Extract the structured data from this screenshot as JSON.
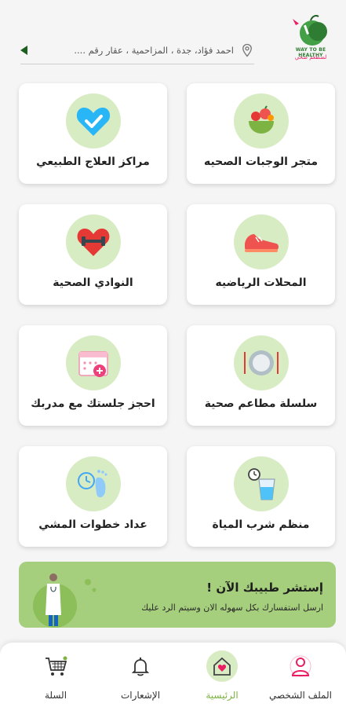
{
  "header": {
    "logo_text_en": "WAY TO BE HEALTHY",
    "logo_text_ar": "لصطعم صحي",
    "location_text": "احمد فؤاد، جدة ، المزاحمية ، عقار رقم ....",
    "pin_icon": "location-pin-icon",
    "back_icon": "back-arrow-icon"
  },
  "services": [
    {
      "label": "متجر الوجبات الصحيه",
      "icon": "healthy-food-bowl-icon"
    },
    {
      "label": "مراكز العلاج الطبيعي",
      "icon": "heart-check-icon"
    },
    {
      "label": "المحلات الرياضيه",
      "icon": "sneaker-icon"
    },
    {
      "label": "النوادي الصحية",
      "icon": "dumbbell-heart-icon"
    },
    {
      "label": "سلسلة مطاعم صحية",
      "icon": "plate-fork-knife-icon"
    },
    {
      "label": "احجز جلستك مع مدربك",
      "icon": "calendar-add-icon"
    },
    {
      "label": "منظم شرب المياة",
      "icon": "water-glass-timer-icon"
    },
    {
      "label": "عداد خطوات المشي",
      "icon": "footstep-counter-icon"
    }
  ],
  "consult": {
    "title": "إستشر طبيبك الآن !",
    "text": "ارسل استفسارك بكل سهوله الان وسيتم الرد عليك",
    "icon": "doctor-illustration"
  },
  "nav": {
    "items": [
      {
        "label": "الملف الشخصي",
        "icon": "profile-icon"
      },
      {
        "label": "الرئيسية",
        "icon": "home-heart-icon",
        "active": true
      },
      {
        "label": "الإشعارات",
        "icon": "bell-icon"
      },
      {
        "label": "السلة",
        "icon": "cart-icon"
      }
    ]
  },
  "colors": {
    "accent": "#7cb342",
    "icon_bg": "#d8ecc4",
    "banner_bg": "#a5cf7d",
    "brand_pink": "#e91e63"
  }
}
